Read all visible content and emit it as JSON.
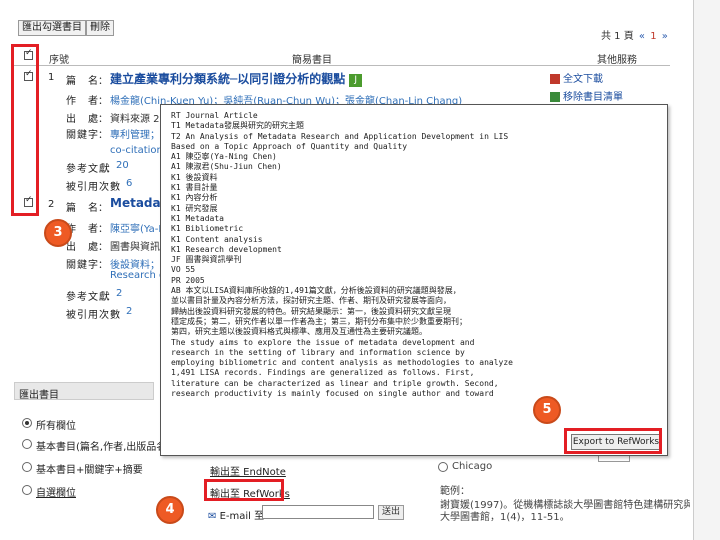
{
  "toolbar": {
    "btn1": "匯出勾選書目",
    "btn2": "刪除"
  },
  "pager": {
    "total": "共 1 頁",
    "prev": "«",
    "page": "1",
    "next": "»"
  },
  "columns": {
    "seq": "序號",
    "biblio": "簡易書目",
    "other": "其他服務"
  },
  "records": [
    {
      "num": "1",
      "title_label": "篇　名",
      "title": "建立產業專利分類系統─以同引證分析的觀點",
      "badge": "J",
      "author_label": "作　者",
      "authors": "楊金龍(Chin-Kuen Yu)；吳純吾(Ruan-Chun Wu)；張金龍(Chan-Lin Chang)",
      "source_label": "出　處",
      "source": "資料來源 22",
      "keyword_label": "關鍵字",
      "keyword": "專利管理；",
      "keyword2": "co-citation；",
      "ref_label": "參考文獻",
      "ref_value": "20",
      "cited_label": "被引用次數",
      "cited_value": "6"
    },
    {
      "num": "2",
      "title_label": "篇　名",
      "title": "Metadata",
      "author_label": "作　者",
      "authors": "陳亞寧(Ya-N",
      "source_label": "出　處",
      "source": "圖書與資訊學",
      "keyword_label": "關鍵字",
      "keyword": "後設資料；",
      "keyword2": "Research d",
      "ref_label": "參考文獻",
      "ref_value": "2",
      "cited_label": "被引用次數",
      "cited_value": "2"
    }
  ],
  "services": {
    "fulltext": "全文下載",
    "add_list": "移除書目清單"
  },
  "export": {
    "header": "匯出書目",
    "options": [
      "所有欄位",
      "基本書目(篇名,作者,出版品名稱...)",
      "基本書目+關鍵字+摘要",
      "自選欄位"
    ],
    "endnote": "輸出至 EndNote",
    "refworks": "輸出至 RefWorks",
    "email_label": "E-mail 至",
    "send": "送出"
  },
  "citation": {
    "style": "Chicago",
    "example_label": "範例：",
    "example1": "謝寶媛(1997)。從機構標誌談大學圖書館特色建構研究與管理。",
    "example2": "大學圖書館，1(4)，11-51。"
  },
  "popup": {
    "lines": [
      "RT Journal Article",
      "T1 Metadata發展與研究的研究主題",
      "T2 An Analysis of Metadata Research and Application Development in LIS",
      "Based on a Topic Approach of Quantity and Quality",
      "A1 陳亞寧(Ya-Ning Chen)",
      "A1 陳淑君(Shu-Jiun Chen)",
      "K1 後設資料",
      "K1 書目計量",
      "K1 內容分析",
      "K1 研究發展",
      "K1 Metadata",
      "K1 Bibliometric",
      "K1 Content analysis",
      "K1 Research development",
      "JF 圖書與資訊學刊",
      "VO 55",
      "PR 2005",
      "AB 本文以LISA資料庫所收錄的1,491篇文獻，分析後設資料的研究議題與發展，",
      "並以書目計量及內容分析方法，探討研究主題、作者、期刊及研究發展等面向，",
      "歸納出後設資料研究發展的特色。研究結果顯示：第一，後設資料研究文獻呈現",
      "穩定成長；第二，研究作者以單一作者為主；第三，期刊分布集中於少數重要期刊；",
      "第四，研究主題以後設資料格式與標準、應用及互通性為主要研究議題。",
      "The study aims to explore the issue of metadata development and",
      "research in the setting of library and information science by",
      "employing bibliometric and content analysis as methodologies to analyze",
      "1,491 LISA records. Findings are generalized as follows. First,",
      "literature can be characterized as linear and triple growth. Second,",
      "research productivity is mainly focused on single author and toward"
    ],
    "button": "Export to RefWorks"
  },
  "badges": {
    "b3": "3",
    "b4": "4",
    "b5": "5"
  },
  "colors": {
    "highlight": "#e31e24",
    "badge": "#ee5a24",
    "link": "#1a4c9e"
  }
}
